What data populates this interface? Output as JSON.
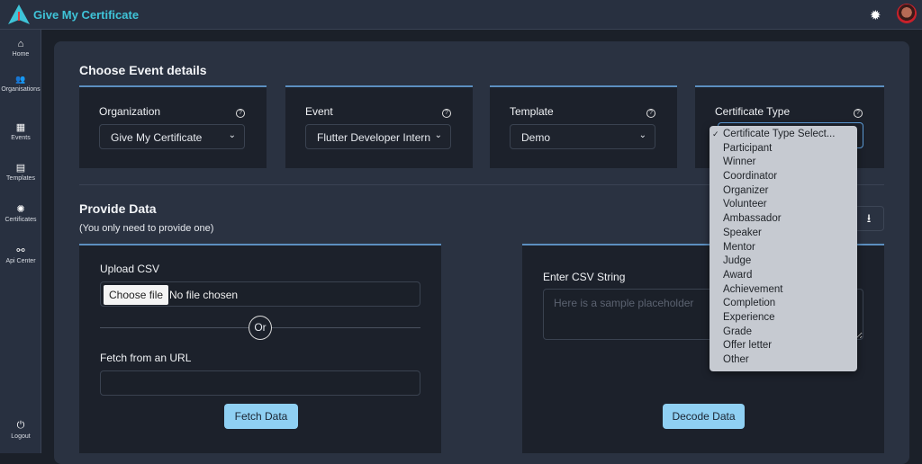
{
  "header": {
    "brand": "Give My Certificate",
    "settings_icon": "gear-icon",
    "avatar": "user-avatar"
  },
  "sidebar": {
    "items": [
      {
        "label": "Home",
        "icon": "⌂"
      },
      {
        "label": "Organisations",
        "icon": "👥"
      },
      {
        "label": "Events",
        "icon": "▦"
      },
      {
        "label": "Templates",
        "icon": "▤"
      },
      {
        "label": "Certificates",
        "icon": "✺"
      },
      {
        "label": "Api Center",
        "icon": "⚯"
      }
    ],
    "logout": {
      "label": "Logout",
      "icon": "⏻"
    }
  },
  "event": {
    "title": "Choose Event details",
    "fields": [
      {
        "label": "Organization",
        "value": "Give My Certificate"
      },
      {
        "label": "Event",
        "value": "Flutter Developer Intern"
      },
      {
        "label": "Template",
        "value": "Demo"
      },
      {
        "label": "Certificate Type",
        "value": "Certificate Type Select..."
      }
    ]
  },
  "cert_type_options": [
    "Certificate Type Select...",
    "Participant",
    "Winner",
    "Coordinator",
    "Organizer",
    "Volunteer",
    "Ambassador",
    "Speaker",
    "Mentor",
    "Judge",
    "Award",
    "Achievement",
    "Completion",
    "Experience",
    "Grade",
    "Offer letter",
    "Other"
  ],
  "data": {
    "title": "Provide Data",
    "subtitle": "(You only need to provide one)",
    "upload_label": "Upload CSV",
    "choose_file": "Choose file",
    "no_file": "No file chosen",
    "or": "Or",
    "url_label": "Fetch from an URL",
    "url_value": "",
    "fetch_button": "Fetch Data",
    "csv_label": "Enter CSV String",
    "csv_placeholder": "Here is a sample placeholder",
    "decode_button": "Decode Data"
  },
  "colors": {
    "accent": "#8fd0f3",
    "brand": "#3fc4d8",
    "card_border": "#5c8fc0"
  }
}
